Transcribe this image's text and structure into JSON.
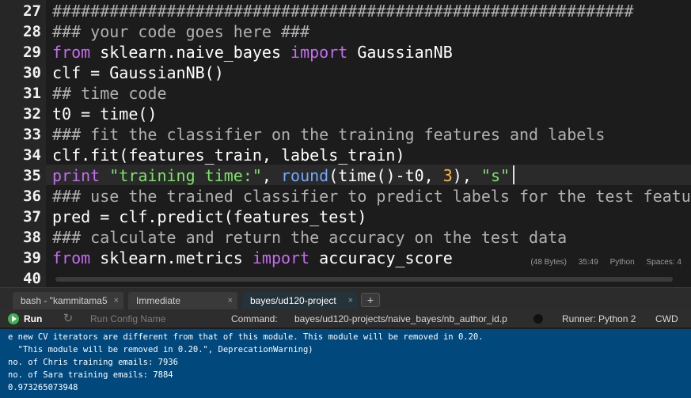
{
  "editor": {
    "line_numbers": [
      "27",
      "28",
      "29",
      "30",
      "31",
      "32",
      "33",
      "34",
      "35",
      "36",
      "37",
      "38",
      "39",
      "40"
    ],
    "lines": [
      [
        {
          "t": "#############################################################",
          "c": "comment"
        }
      ],
      [
        {
          "t": "### your code goes here ###",
          "c": "comment"
        }
      ],
      [
        {
          "t": "from",
          "c": "keyword"
        },
        {
          "t": " sklearn.naive_bayes ",
          "c": "plain"
        },
        {
          "t": "import",
          "c": "keyword"
        },
        {
          "t": " GaussianNB",
          "c": "plain"
        }
      ],
      [
        {
          "t": "clf = GaussianNB()",
          "c": "plain"
        }
      ],
      [
        {
          "t": "## time code",
          "c": "comment"
        }
      ],
      [
        {
          "t": "t0 = time()",
          "c": "plain"
        }
      ],
      [
        {
          "t": "### fit the classifier on the training features and labels",
          "c": "comment"
        }
      ],
      [
        {
          "t": "clf.fit(features_train, labels_train)",
          "c": "plain"
        }
      ],
      [
        {
          "t": "print",
          "c": "keyword"
        },
        {
          "t": " ",
          "c": "plain"
        },
        {
          "t": "\"training time:\"",
          "c": "string"
        },
        {
          "t": ", ",
          "c": "plain"
        },
        {
          "t": "round",
          "c": "builtin"
        },
        {
          "t": "(time()-t0, ",
          "c": "plain"
        },
        {
          "t": "3",
          "c": "number"
        },
        {
          "t": "), ",
          "c": "plain"
        },
        {
          "t": "\"s\"",
          "c": "string"
        }
      ],
      [
        {
          "t": "### use the trained classifier to predict labels for the test featu",
          "c": "comment"
        }
      ],
      [
        {
          "t": "pred = clf.predict(features_test)",
          "c": "plain"
        }
      ],
      [
        {
          "t": "### calculate and return the accuracy on the test data",
          "c": "comment"
        }
      ],
      [
        {
          "t": "from",
          "c": "keyword"
        },
        {
          "t": " sklearn.metrics ",
          "c": "plain"
        },
        {
          "t": "import",
          "c": "keyword"
        },
        {
          "t": " accuracy_score",
          "c": "plain"
        }
      ],
      [
        {
          "t": "",
          "c": "plain"
        }
      ]
    ],
    "status": {
      "size": "(48 Bytes)",
      "position": "35:49",
      "language": "Python",
      "spaces": "Spaces: 4"
    }
  },
  "tabs": [
    {
      "label": "bash - \"kammitama5",
      "close": "×",
      "active": false
    },
    {
      "label": "Immediate",
      "close": "×",
      "active": false
    },
    {
      "label": "bayes/ud120-project",
      "close": "×",
      "active": true
    }
  ],
  "tab_add_label": "+",
  "runbar": {
    "run_label": "Run",
    "run_config_label": "Run Config Name",
    "command_label": "Command:",
    "command_value": "bayes/ud120-projects/naive_bayes/nb_author_id.p",
    "runner_label": "Runner: Python 2",
    "cwd_label": "CWD"
  },
  "console_lines": [
    "e new CV iterators are different from that of this module. This module will be removed in 0.20.",
    "  \"This module will be removed in 0.20.\", DeprecationWarning)",
    "no. of Chris training emails: 7936",
    "no. of Sara training emails: 7884",
    "0.973265073948"
  ],
  "colors": {
    "editor_bg": "#1c1c1c",
    "gutter_bg": "#262626",
    "keyword": "#c56cf0",
    "string": "#7ce36a",
    "number": "#ffb74a",
    "builtin": "#6fa9ff",
    "comment": "#b0b0b0",
    "console_bg": "#01487c",
    "run_icon": "#3fb24f"
  }
}
